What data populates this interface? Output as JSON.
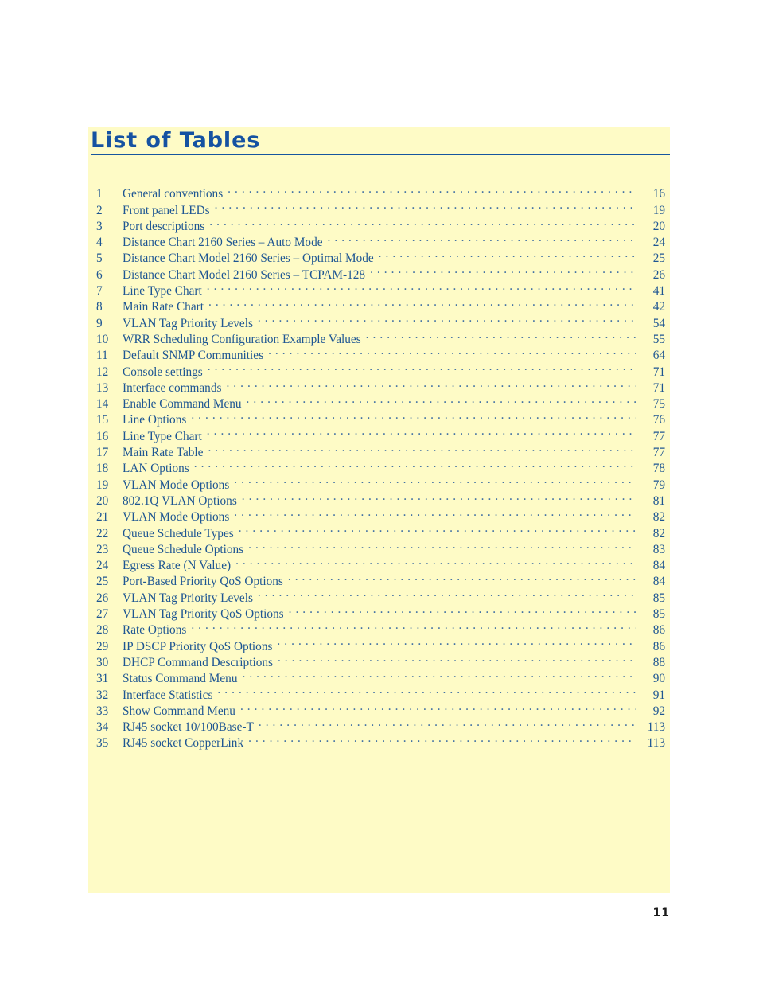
{
  "document": {
    "section_title": "List of Tables",
    "folio": "11"
  },
  "colors": {
    "panel_background": "#fefbc6",
    "title_blue": "#1552a2",
    "rule_blue": "#16559f",
    "entry_blue": "#1e5693",
    "leader_blue": "#3f6fa4",
    "folio_black": "#1a1a1a",
    "page_background": "#ffffff"
  },
  "toc": {
    "entries": [
      {
        "number": "1",
        "title": "General conventions",
        "page": "16"
      },
      {
        "number": "2",
        "title": "Front panel LEDs",
        "page": "19"
      },
      {
        "number": "3",
        "title": "Port descriptions",
        "page": "20"
      },
      {
        "number": "4",
        "title": "Distance Chart 2160 Series – Auto Mode",
        "page": "24"
      },
      {
        "number": "5",
        "title": "Distance Chart Model 2160 Series – Optimal Mode",
        "page": "25"
      },
      {
        "number": "6",
        "title": "Distance Chart Model 2160 Series – TCPAM-128",
        "page": "26"
      },
      {
        "number": "7",
        "title": "Line Type Chart",
        "page": "41"
      },
      {
        "number": "8",
        "title": "Main Rate Chart",
        "page": "42"
      },
      {
        "number": "9",
        "title": "VLAN Tag Priority Levels",
        "page": "54"
      },
      {
        "number": "10",
        "title": "WRR Scheduling Configuration Example Values",
        "page": "55"
      },
      {
        "number": "11",
        "title": "Default SNMP Communities",
        "page": "64"
      },
      {
        "number": "12",
        "title": "Console settings",
        "page": "71"
      },
      {
        "number": "13",
        "title": "Interface commands",
        "page": "71"
      },
      {
        "number": "14",
        "title": "Enable Command Menu",
        "page": "75"
      },
      {
        "number": "15",
        "title": "Line Options",
        "page": "76"
      },
      {
        "number": "16",
        "title": "Line Type Chart",
        "page": "77"
      },
      {
        "number": "17",
        "title": "Main Rate Table",
        "page": "77"
      },
      {
        "number": "18",
        "title": "LAN Options",
        "page": "78"
      },
      {
        "number": "19",
        "title": "VLAN Mode Options",
        "page": "79"
      },
      {
        "number": "20",
        "title": "802.1Q VLAN Options",
        "page": "81"
      },
      {
        "number": "21",
        "title": "VLAN Mode Options",
        "page": "82"
      },
      {
        "number": "22",
        "title": "Queue Schedule Types",
        "page": "82"
      },
      {
        "number": "23",
        "title": "Queue Schedule Options",
        "page": "83"
      },
      {
        "number": "24",
        "title": "Egress Rate (N Value)",
        "page": "84"
      },
      {
        "number": "25",
        "title": "Port-Based Priority QoS Options",
        "page": "84"
      },
      {
        "number": "26",
        "title": "VLAN Tag Priority Levels",
        "page": "85"
      },
      {
        "number": "27",
        "title": "VLAN Tag Priority QoS Options",
        "page": "85"
      },
      {
        "number": "28",
        "title": "Rate Options",
        "page": "86"
      },
      {
        "number": "29",
        "title": "IP DSCP Priority QoS Options",
        "page": "86"
      },
      {
        "number": "30",
        "title": "DHCP Command Descriptions",
        "page": "88"
      },
      {
        "number": "31",
        "title": "Status Command Menu",
        "page": "90"
      },
      {
        "number": "32",
        "title": "Interface Statistics",
        "page": "91"
      },
      {
        "number": "33",
        "title": "Show Command Menu",
        "page": "92"
      },
      {
        "number": "34",
        "title": "RJ45 socket 10/100Base-T",
        "page": "113"
      },
      {
        "number": "35",
        "title": "RJ45 socket CopperLink",
        "page": "113"
      }
    ]
  }
}
